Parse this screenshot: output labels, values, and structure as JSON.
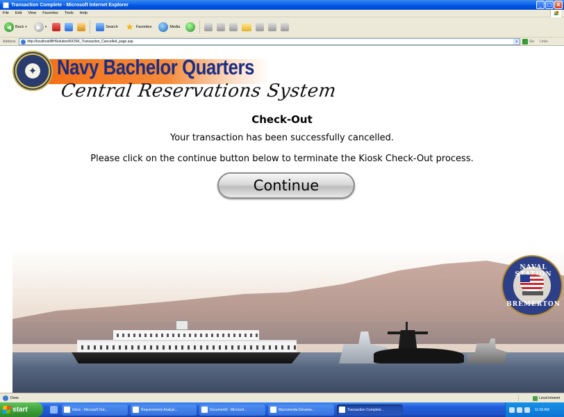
{
  "window": {
    "title": "Transaction Complete - Microsoft Internet Explorer",
    "buttons": [
      "_",
      "□",
      "X"
    ]
  },
  "menu": [
    "File",
    "Edit",
    "View",
    "Favorites",
    "Tools",
    "Help"
  ],
  "toolbar": {
    "back_label": "Back",
    "search_label": "Search",
    "favorites_label": "Favorites",
    "media_label": "Media"
  },
  "address": {
    "label": "Address",
    "url": "http://localhost/BHSolution/KIOSK_Transaction_Cancelled_page.asp",
    "go_label": "Go",
    "links_label": "Links"
  },
  "page": {
    "brand_title": "Navy Bachelor Quarters",
    "brand_subtitle": "Central Reservations System",
    "heading": "Check-Out",
    "message1": "Your transaction has been successfully cancelled.",
    "message2": "Please click on the continue button below to terminate the Kiosk Check-Out process.",
    "continue_label": "Continue",
    "emblem_top": "NAVAL STATION",
    "emblem_bottom": "BREMERTON"
  },
  "status": {
    "text": "Done",
    "zone": "Local intranet"
  },
  "taskbar": {
    "start_label": "start",
    "tasks": [
      {
        "label": "Inbox - Microsoft Out..."
      },
      {
        "label": "Requirements Analysi..."
      },
      {
        "label": "Document3 - Microsof..."
      },
      {
        "label": "Macromedia Dreamw..."
      },
      {
        "label": "Transaction Complete..."
      }
    ],
    "clock": "11:59 AM"
  }
}
